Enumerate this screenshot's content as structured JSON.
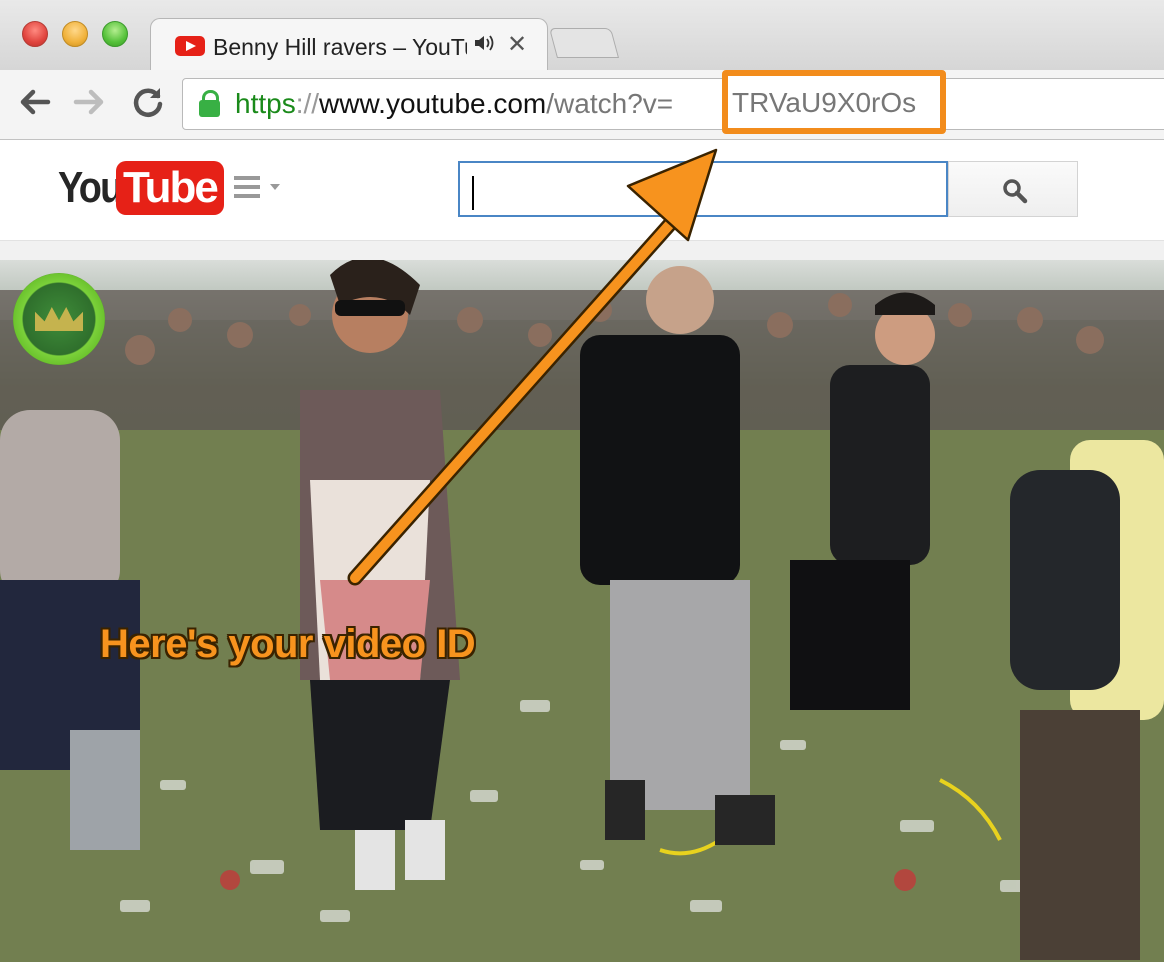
{
  "browser": {
    "tab": {
      "title": "Benny Hill ravers – YouTube",
      "favicon": "youtube-favicon-icon",
      "audio_icon": "speaker-icon",
      "close_label": "✕"
    },
    "nav": {
      "back_icon": "back-arrow-icon",
      "forward_icon": "forward-arrow-icon",
      "reload_icon": "reload-icon"
    },
    "address_bar": {
      "secure_icon": "lock-icon",
      "scheme": "https",
      "separator": "://",
      "host": "www.youtube.com",
      "path": "/watch?v=",
      "video_id": "TRVaU9X0rOs"
    }
  },
  "youtube": {
    "logo": {
      "you": "You",
      "tube": "Tube"
    },
    "guide_icon": "hamburger-menu-icon",
    "search": {
      "value": "",
      "placeholder": ""
    },
    "search_button_icon": "search-icon",
    "colors": {
      "brand_red": "#e62117",
      "search_focus": "#4a86c5"
    }
  },
  "video": {
    "channel_badge_icon": "channel-watermark-icon"
  },
  "annotation": {
    "callout": "Here's your video ID",
    "color": "#f28c1c"
  }
}
